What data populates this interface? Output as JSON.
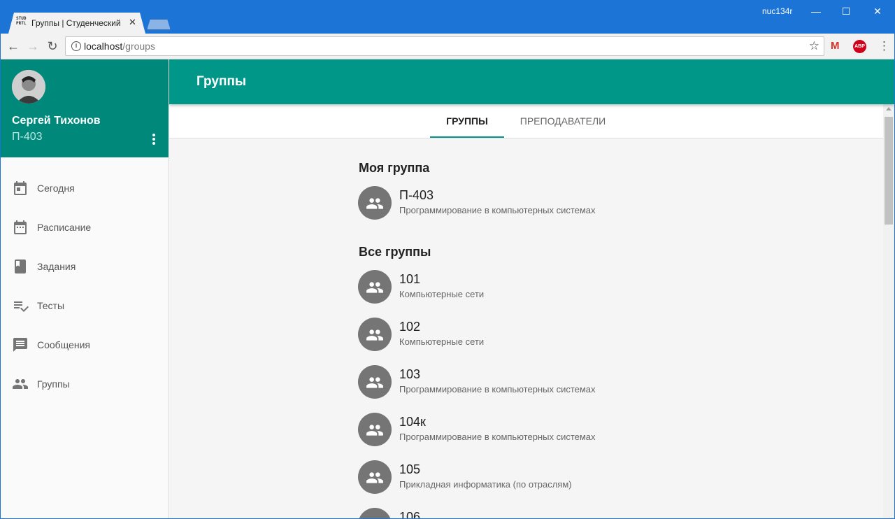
{
  "browser": {
    "tab_title": "Группы | Студенческий",
    "favicon_text": "STUD PRTL",
    "user": "nuc134r",
    "url_host": "localhost",
    "url_path": "/groups",
    "ext_gmail": "M",
    "ext_abp": "ABP"
  },
  "profile": {
    "name": "Сергей Тихонов",
    "group": "П-403"
  },
  "nav": {
    "items": [
      {
        "label": "Сегодня",
        "icon": "calendar-today-icon"
      },
      {
        "label": "Расписание",
        "icon": "calendar-icon"
      },
      {
        "label": "Задания",
        "icon": "book-icon"
      },
      {
        "label": "Тесты",
        "icon": "playlist-check-icon"
      },
      {
        "label": "Сообщения",
        "icon": "message-icon"
      },
      {
        "label": "Группы",
        "icon": "group-icon"
      }
    ]
  },
  "appbar": {
    "title": "Группы"
  },
  "tabs": [
    {
      "label": "ГРУППЫ",
      "active": true
    },
    {
      "label": "ПРЕПОДАВАТЕЛИ",
      "active": false
    }
  ],
  "my_group": {
    "title": "Моя группа",
    "item": {
      "name": "П-403",
      "spec": "Программирование в компьютерных системах"
    }
  },
  "all_groups": {
    "title": "Все группы",
    "items": [
      {
        "name": "101",
        "spec": "Компьютерные сети"
      },
      {
        "name": "102",
        "spec": "Компьютерные сети"
      },
      {
        "name": "103",
        "spec": "Программирование в компьютерных системах"
      },
      {
        "name": "104к",
        "spec": "Программирование в компьютерных системах"
      },
      {
        "name": "105",
        "spec": "Прикладная информатика (по отраслям)"
      },
      {
        "name": "106",
        "spec": ""
      }
    ]
  },
  "colors": {
    "accent": "#009688",
    "profile_bg": "#00897b",
    "chrome": "#1b74d6"
  }
}
